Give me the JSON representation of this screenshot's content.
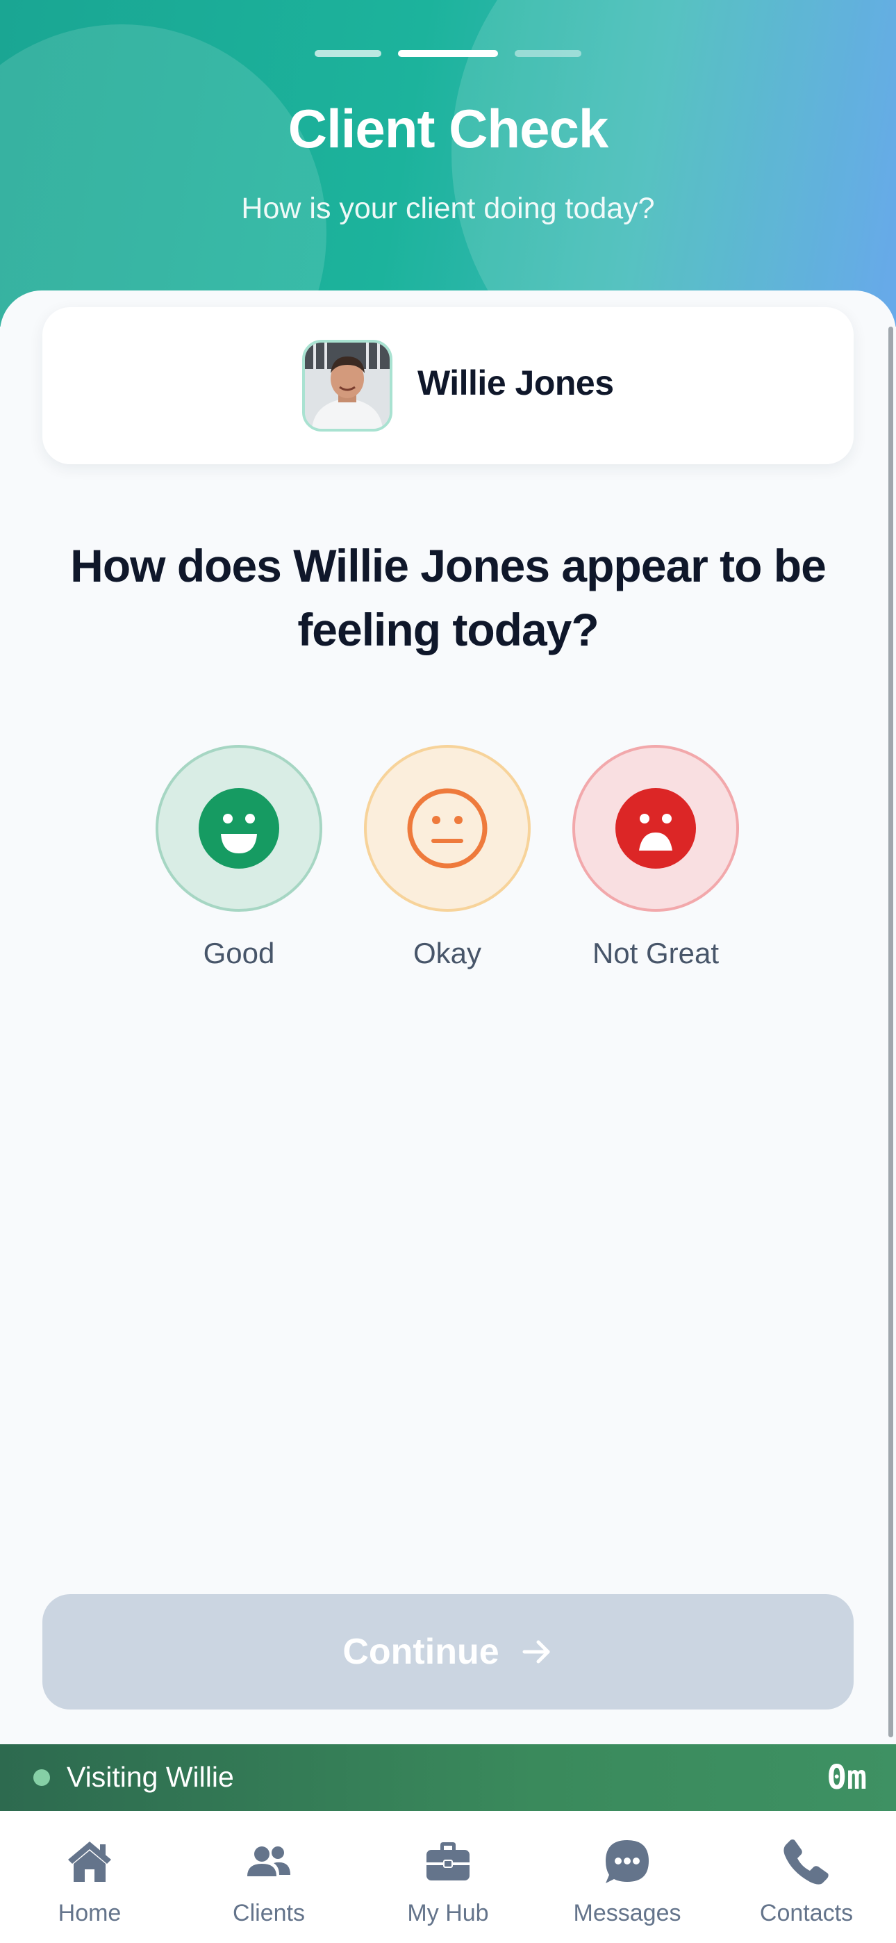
{
  "header": {
    "title": "Client Check",
    "subtitle": "How is your client doing today?",
    "progress": {
      "total_steps": 3,
      "current_step": 2
    }
  },
  "client": {
    "name": "Willie Jones",
    "avatar_icon": "client-photo"
  },
  "question": "How does Willie Jones appear to be feeling today?",
  "moods": [
    {
      "label": "Good",
      "icon": "smile-face-icon",
      "color": "#169b62"
    },
    {
      "label": "Okay",
      "icon": "neutral-face-icon",
      "color": "#ee7a3c"
    },
    {
      "label": "Not Great",
      "icon": "sad-face-icon",
      "color": "#dc2626"
    }
  ],
  "continue_button": {
    "label": "Continue",
    "icon": "arrow-right-icon",
    "enabled": false
  },
  "visit_status": {
    "text": "Visiting Willie",
    "timer": "0m"
  },
  "tabs": [
    {
      "label": "Home",
      "icon": "home-icon"
    },
    {
      "label": "Clients",
      "icon": "users-icon"
    },
    {
      "label": "My Hub",
      "icon": "briefcase-icon"
    },
    {
      "label": "Messages",
      "icon": "chat-icon"
    },
    {
      "label": "Contacts",
      "icon": "phone-icon"
    }
  ],
  "colors": {
    "brand_teal": "#1cb39c",
    "visit_green": "#3a8a5c",
    "disabled_button": "#cbd5e1"
  }
}
